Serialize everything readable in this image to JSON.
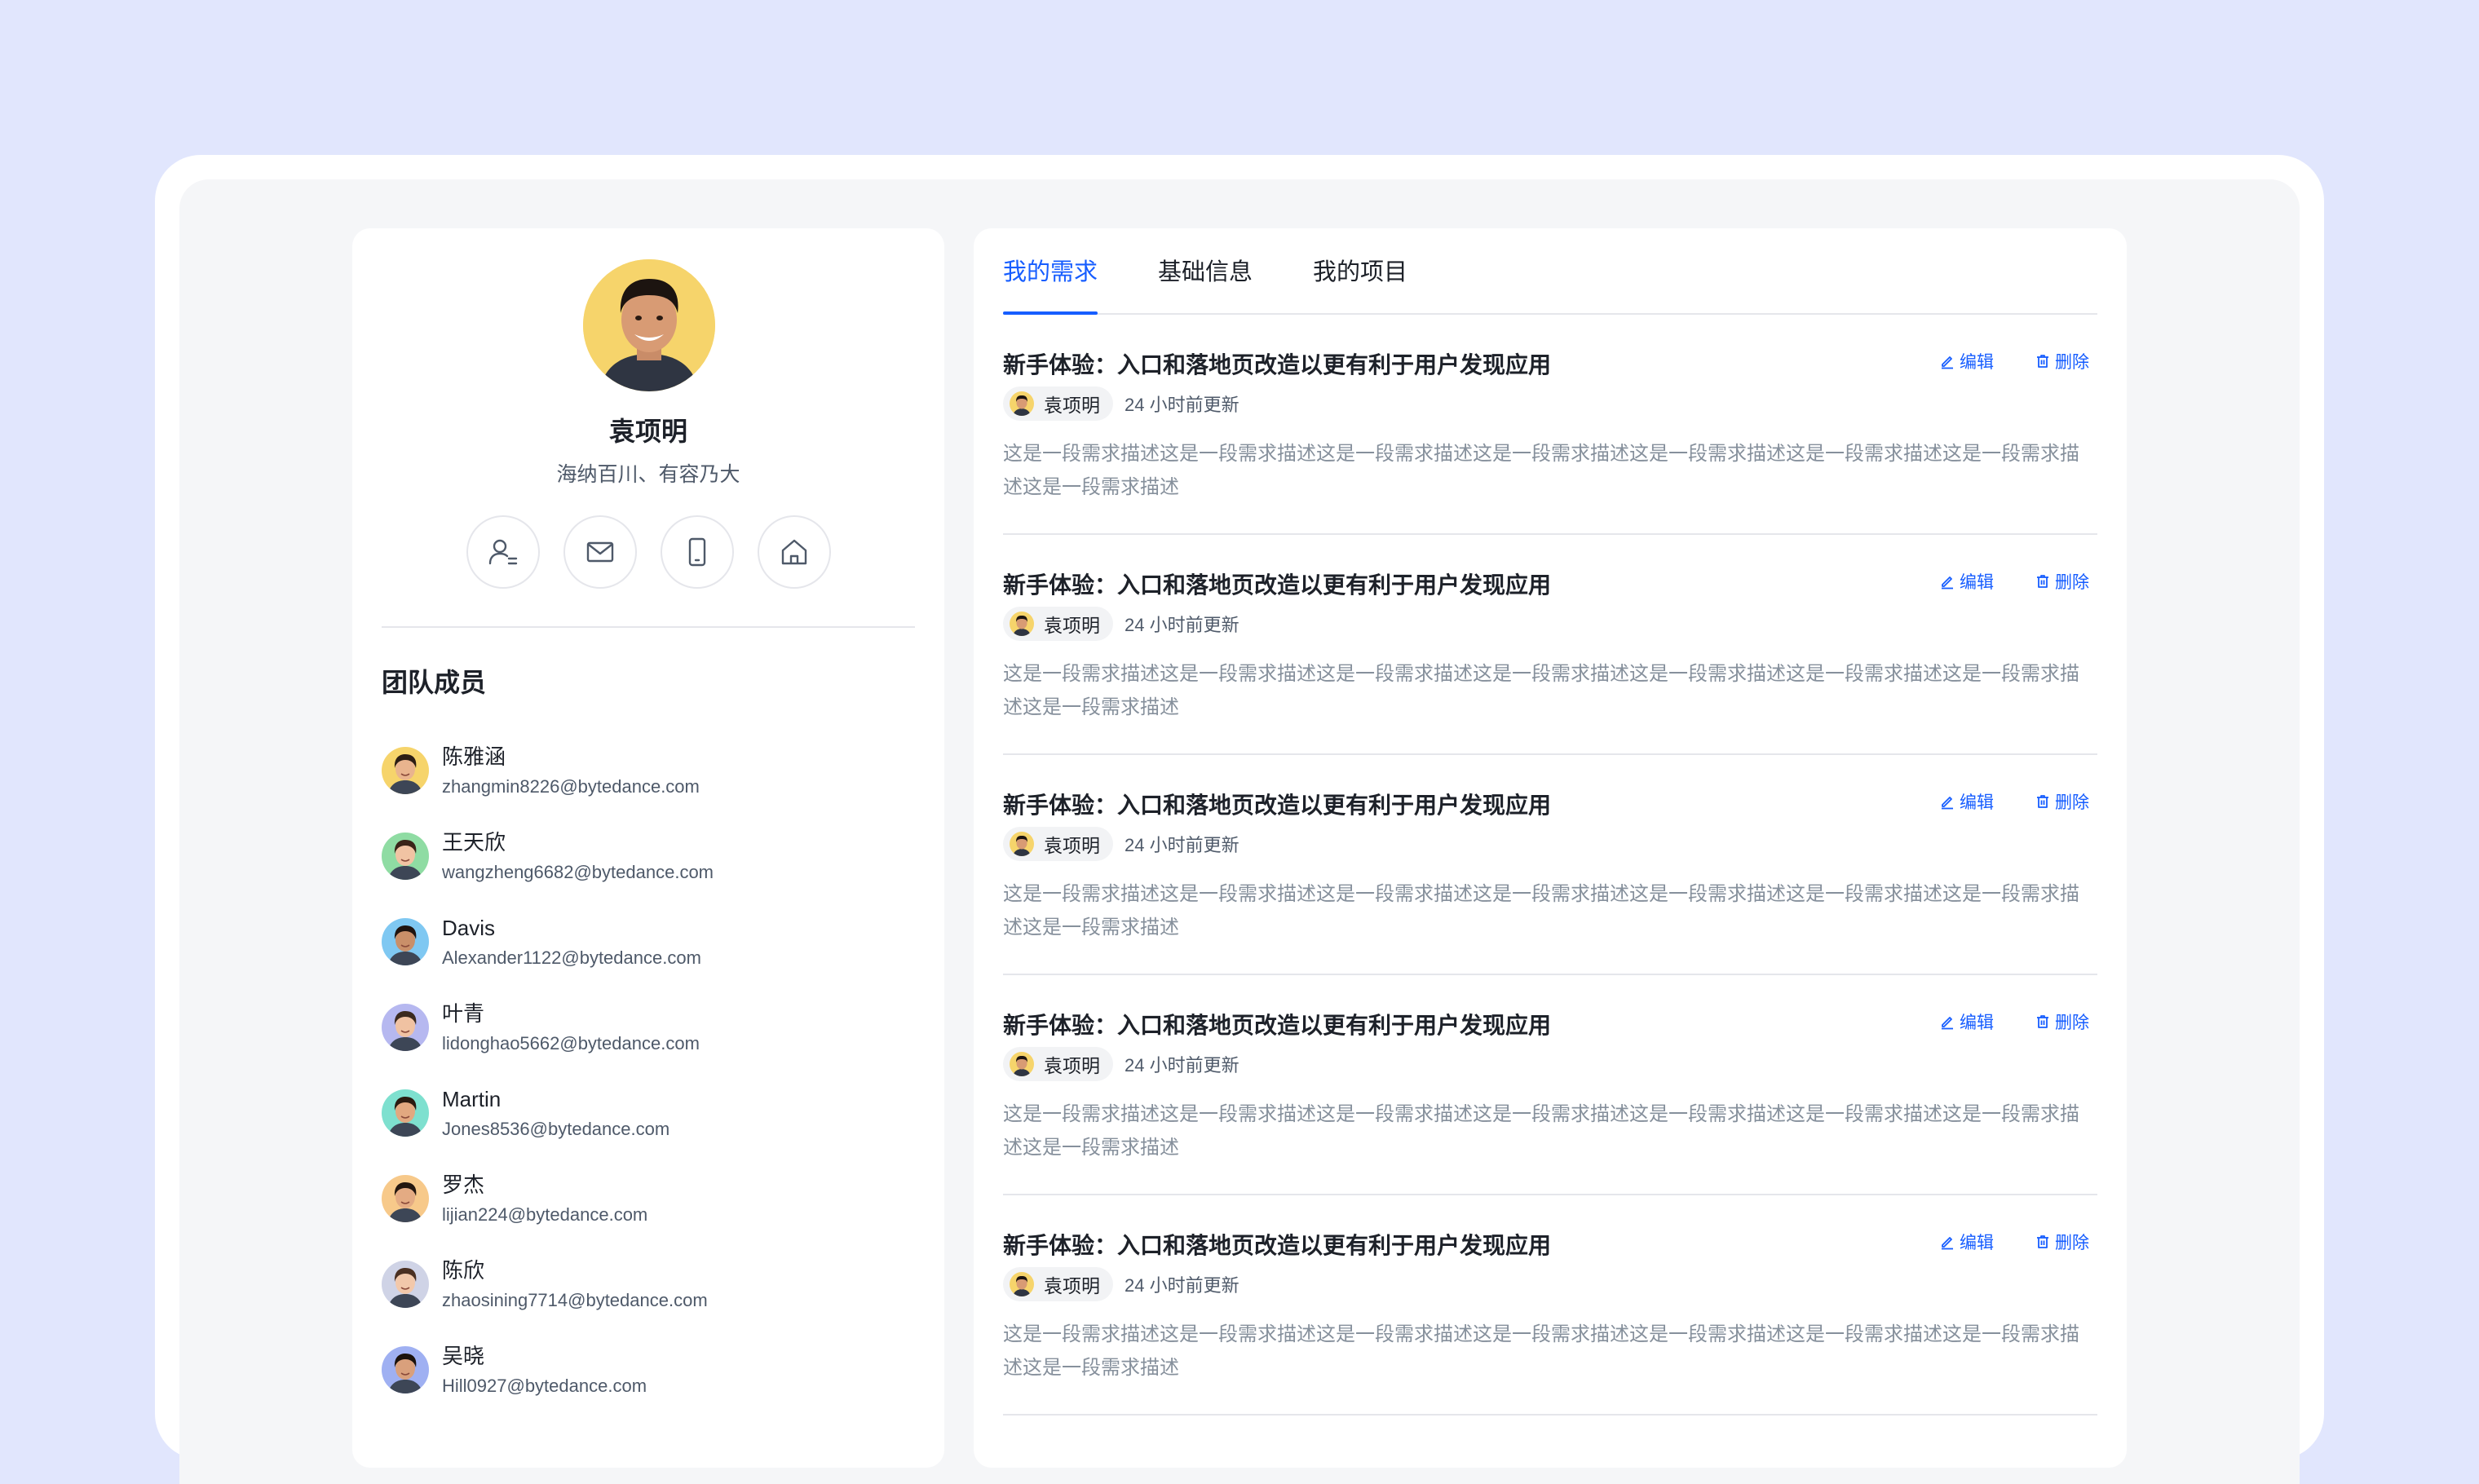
{
  "profile": {
    "name": "袁项明",
    "motto": "海纳百川、有容乃大",
    "contact_icons": [
      "user-list-icon",
      "mail-icon",
      "phone-icon",
      "home-icon"
    ]
  },
  "team": {
    "title": "团队成员",
    "members": [
      {
        "name": "陈雅涵",
        "email": "zhangmin8226@bytedance.com",
        "bg": "#f6d46b",
        "skin": "#e9b48e",
        "hair": "#2b1d14"
      },
      {
        "name": "王天欣",
        "email": "wangzheng6682@bytedance.com",
        "bg": "#8fdca3",
        "skin": "#f1c3a3",
        "hair": "#3a2418"
      },
      {
        "name": "Davis",
        "email": "Alexander1122@bytedance.com",
        "bg": "#7fc8f2",
        "skin": "#c98f69",
        "hair": "#1f1410"
      },
      {
        "name": "叶青",
        "email": "lidonghao5662@bytedance.com",
        "bg": "#b6b8f0",
        "skin": "#f0c2a2",
        "hair": "#3b2a1e"
      },
      {
        "name": "Martin",
        "email": "Jones8536@bytedance.com",
        "bg": "#7ee0cf",
        "skin": "#e2a880",
        "hair": "#2a1a10"
      },
      {
        "name": "罗杰",
        "email": "lijian224@bytedance.com",
        "bg": "#f7c98a",
        "skin": "#e4ab83",
        "hair": "#24170f"
      },
      {
        "name": "陈欣",
        "email": "zhaosining7714@bytedance.com",
        "bg": "#cfd3e6",
        "skin": "#f2c8aa",
        "hair": "#4a3022"
      },
      {
        "name": "吴晓",
        "email": "Hill0927@bytedance.com",
        "bg": "#9fb0f2",
        "skin": "#d9a07c",
        "hair": "#1b120c"
      }
    ]
  },
  "tabs": [
    {
      "label": "我的需求",
      "active": true
    },
    {
      "label": "基础信息",
      "active": false
    },
    {
      "label": "我的项目",
      "active": false
    }
  ],
  "requirements": {
    "edit_label": "编辑",
    "delete_label": "删除",
    "items": [
      {
        "title": "新手体验：入口和落地页改造以更有利于用户发现应用",
        "owner": "袁项明",
        "updated": "24 小时前更新",
        "desc": "这是一段需求描述这是一段需求描述这是一段需求描述这是一段需求描述这是一段需求描述这是一段需求描述这是一段需求描述这是一段需求描述"
      },
      {
        "title": "新手体验：入口和落地页改造以更有利于用户发现应用",
        "owner": "袁项明",
        "updated": "24 小时前更新",
        "desc": "这是一段需求描述这是一段需求描述这是一段需求描述这是一段需求描述这是一段需求描述这是一段需求描述这是一段需求描述这是一段需求描述"
      },
      {
        "title": "新手体验：入口和落地页改造以更有利于用户发现应用",
        "owner": "袁项明",
        "updated": "24 小时前更新",
        "desc": "这是一段需求描述这是一段需求描述这是一段需求描述这是一段需求描述这是一段需求描述这是一段需求描述这是一段需求描述这是一段需求描述"
      },
      {
        "title": "新手体验：入口和落地页改造以更有利于用户发现应用",
        "owner": "袁项明",
        "updated": "24 小时前更新",
        "desc": "这是一段需求描述这是一段需求描述这是一段需求描述这是一段需求描述这是一段需求描述这是一段需求描述这是一段需求描述这是一段需求描述"
      },
      {
        "title": "新手体验：入口和落地页改造以更有利于用户发现应用",
        "owner": "袁项明",
        "updated": "24 小时前更新",
        "desc": "这是一段需求描述这是一段需求描述这是一段需求描述这是一段需求描述这是一段需求描述这是一段需求描述这是一段需求描述这是一段需求描述"
      }
    ]
  },
  "colors": {
    "page_bg": "#e1e6fd",
    "accent": "#165dff",
    "profile_avatar_bg": "#f6d46b"
  }
}
